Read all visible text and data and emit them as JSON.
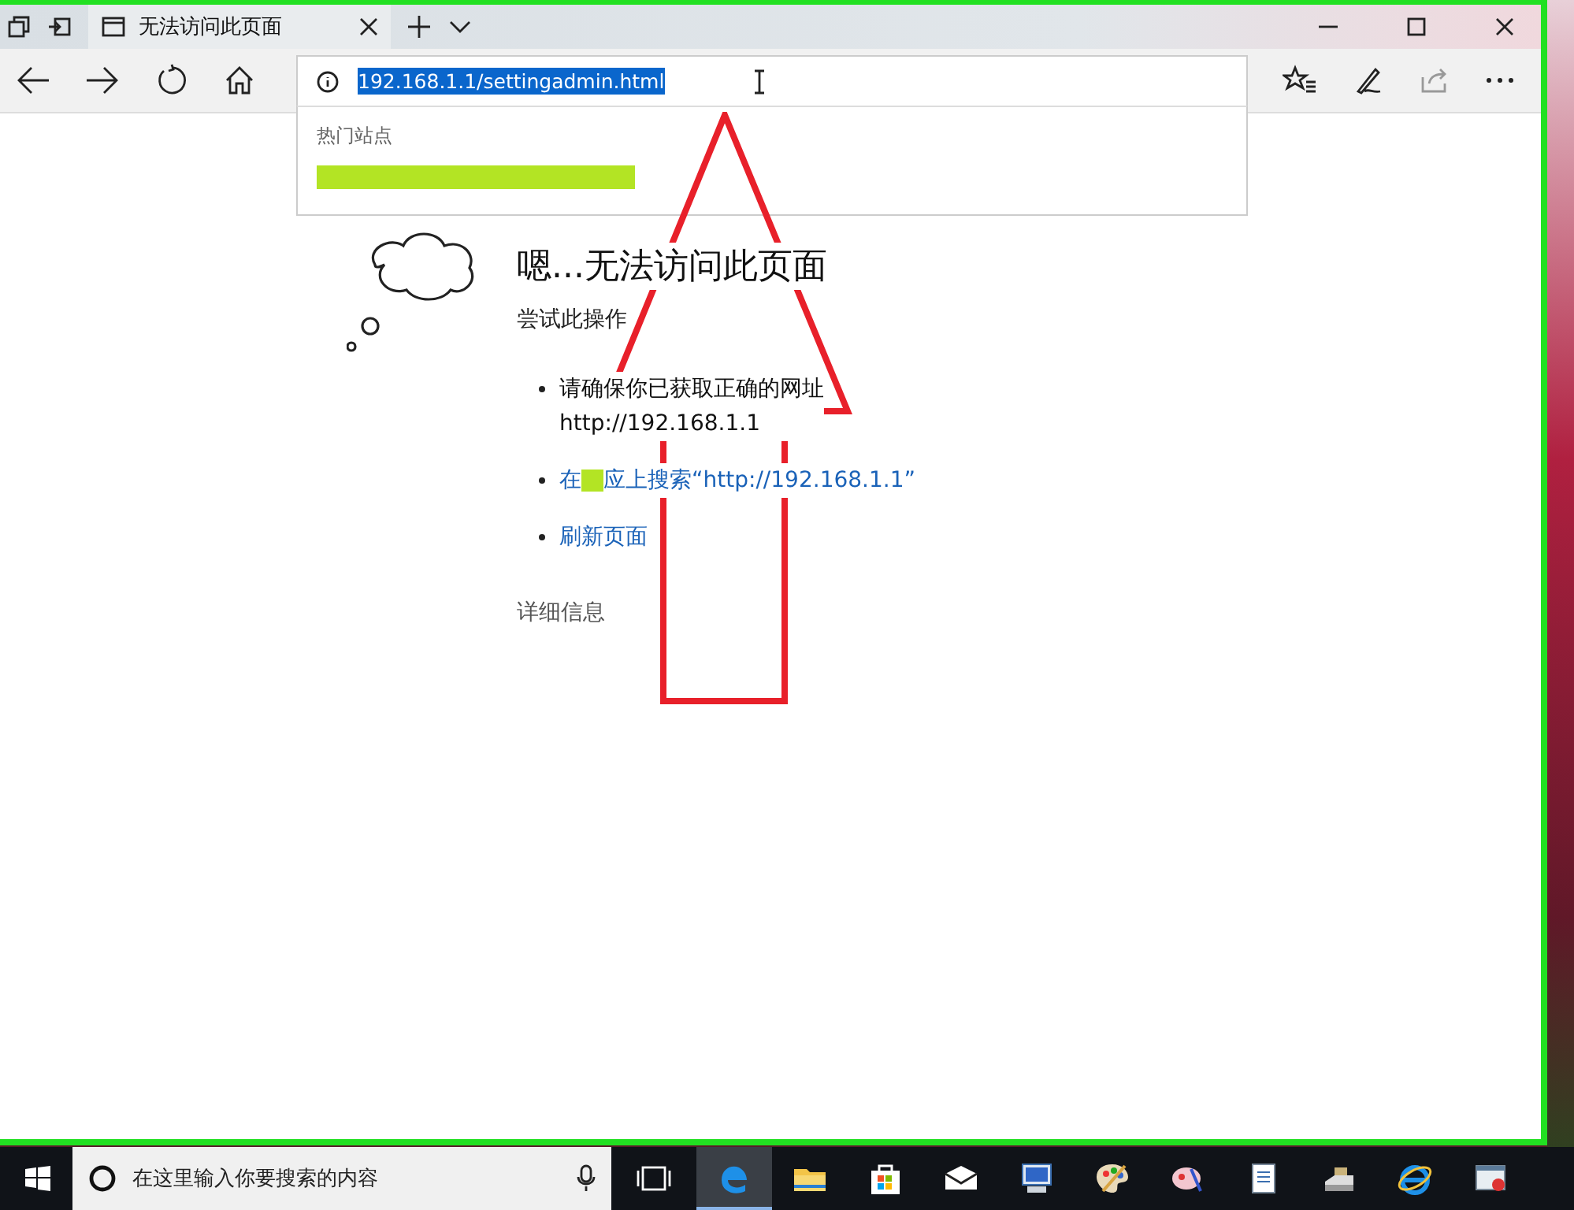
{
  "window": {
    "tabs": [
      {
        "title": "无法访问此页面",
        "selected": true
      }
    ]
  },
  "address_bar": {
    "value": "192.168.1.1/settingadmin.html",
    "selected": true
  },
  "suggestions": {
    "heading": "热门站点",
    "items": [
      {
        "redacted": true
      }
    ]
  },
  "error_page": {
    "title": "嗯...无法访问此页面",
    "subtitle": "尝试此操作",
    "items": [
      {
        "kind": "text",
        "text": "请确保你已获取正确的网址",
        "detail": "http://192.168.1.1"
      },
      {
        "kind": "link",
        "prefix": "在",
        "redacted": true,
        "text": "应上搜索“http://192.168.1.1”"
      },
      {
        "kind": "link",
        "text": "刷新页面"
      }
    ],
    "details": "详细信息"
  },
  "taskbar": {
    "search_placeholder": "在这里输入你要搜索的内容",
    "apps": [
      {
        "kind": "edge",
        "selected": true
      },
      {
        "kind": "folder",
        "selected": false
      },
      {
        "kind": "store",
        "selected": false
      },
      {
        "kind": "mail",
        "selected": false
      },
      {
        "kind": "computer",
        "selected": false
      },
      {
        "kind": "palette",
        "selected": false
      },
      {
        "kind": "brush",
        "selected": false
      },
      {
        "kind": "notepad",
        "selected": false
      },
      {
        "kind": "scanner",
        "selected": false
      },
      {
        "kind": "ie",
        "selected": false
      },
      {
        "kind": "window",
        "selected": false
      }
    ]
  }
}
